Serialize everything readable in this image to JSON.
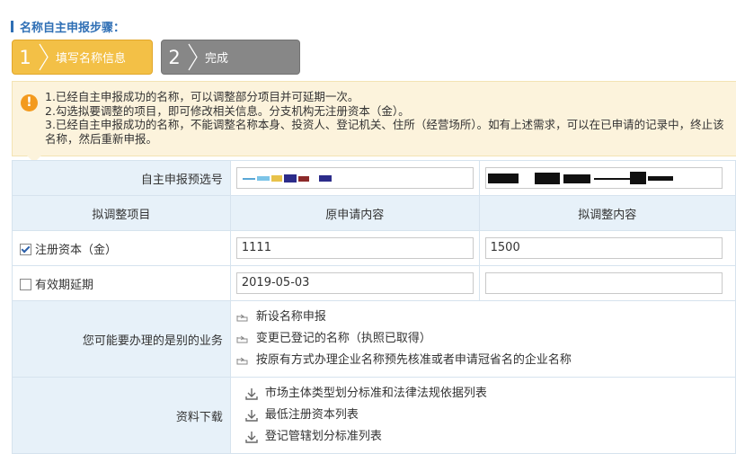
{
  "section_title": "名称自主申报步骤：",
  "steps": [
    {
      "num": "1",
      "label": "填写名称信息"
    },
    {
      "num": "2",
      "label": "完成"
    }
  ],
  "notice": {
    "lines": [
      "1.已经自主申报成功的名称，可以调整部分项目并可延期一次。",
      "2.勾选拟要调整的项目，即可修改相关信息。分支机构无注册资本（金）。",
      "3.已经自主申报成功的名称，不能调整名称本身、投资人、登记机关、住所（经营场所）。如有上述需求，可以在已申请的记录中，终止该名称，然后重新申报。"
    ]
  },
  "form": {
    "preselect_label": "自主申报预选号",
    "header": {
      "item": "拟调整项目",
      "original": "原申请内容",
      "adjusted": "拟调整内容"
    },
    "rows": [
      {
        "label": "注册资本（金）",
        "checked": true,
        "original": "1111",
        "adjusted": "1500"
      },
      {
        "label": "有效期延期",
        "checked": false,
        "original": "2019-05-03",
        "adjusted": ""
      }
    ],
    "other_business_label": "您可能要办理的是别的业务",
    "other_business": [
      "新设名称申报",
      "变更已登记的名称（执照已取得）",
      "按原有方式办理企业名称预先核准或者申请冠省名的企业名称"
    ],
    "downloads_label": "资料下载",
    "downloads": [
      "市场主体类型划分标准和法律法规依据列表",
      "最低注册资本列表",
      "登记管辖划分标准列表"
    ]
  },
  "colors": {
    "accent": "#2f6fb5",
    "step_active": "#f3c046",
    "step_inactive": "#878787",
    "notice_bg": "#fcf3dc",
    "warn": "#f39a1e"
  }
}
